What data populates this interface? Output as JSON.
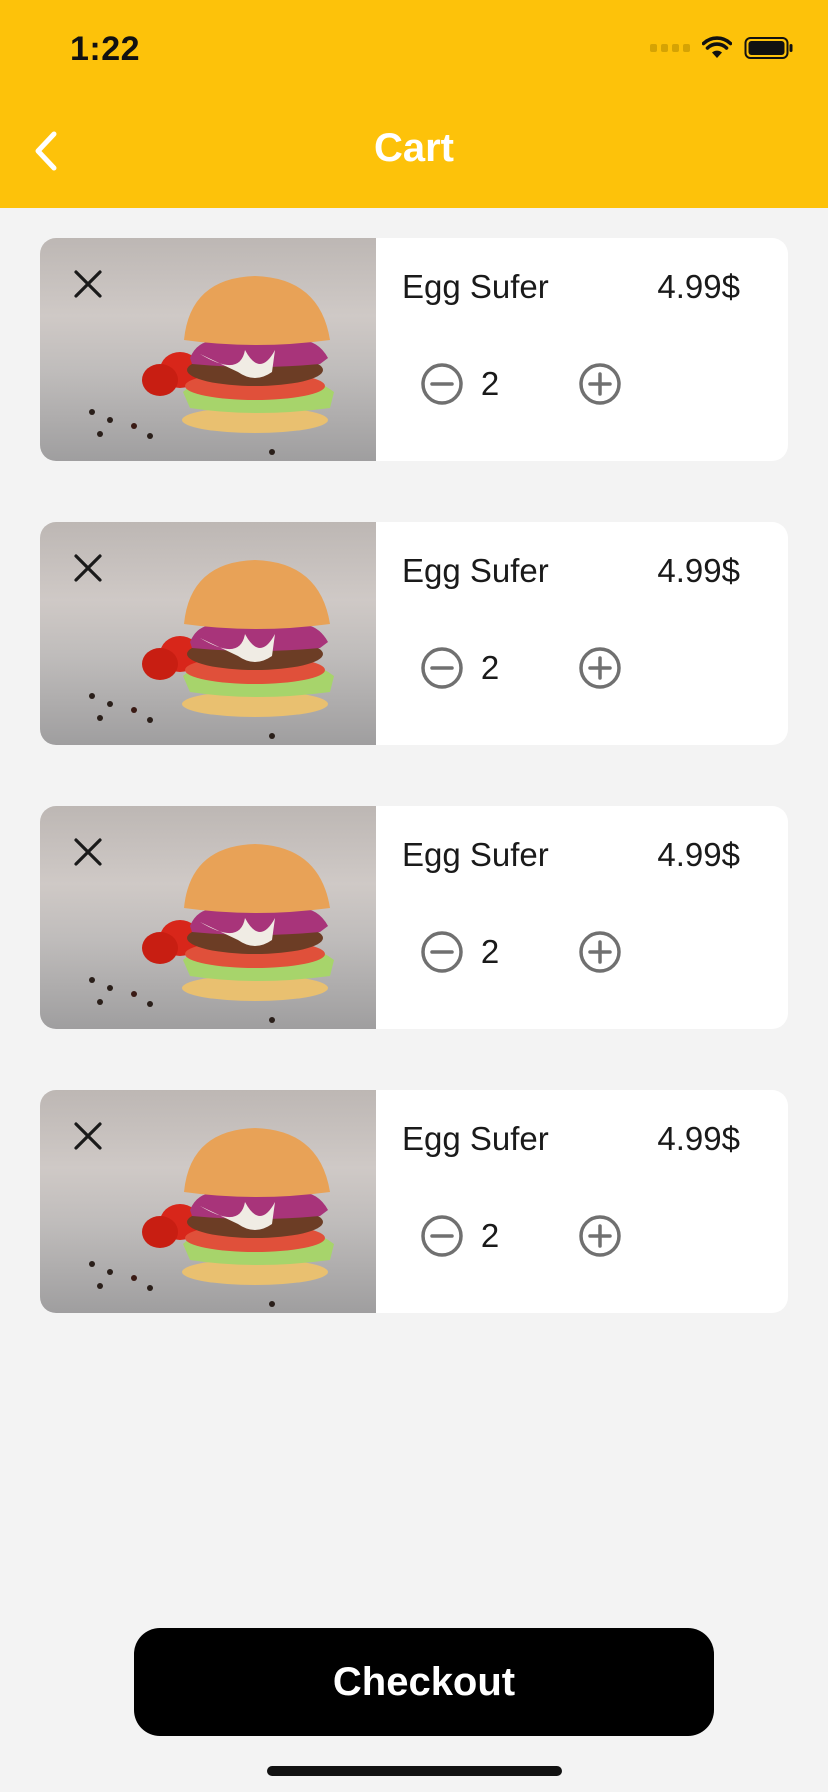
{
  "status_bar": {
    "time": "1:22"
  },
  "header": {
    "title": "Cart"
  },
  "colors": {
    "header_bg": "#fdc20a",
    "background": "#f3f3f3",
    "button_bg": "#000000"
  },
  "cart": {
    "items": [
      {
        "name": "Egg Sufer",
        "price": "4.99$",
        "quantity": "2",
        "image": "burger-image"
      },
      {
        "name": "Egg Sufer",
        "price": "4.99$",
        "quantity": "2",
        "image": "burger-image"
      },
      {
        "name": "Egg Sufer",
        "price": "4.99$",
        "quantity": "2",
        "image": "burger-image"
      },
      {
        "name": "Egg Sufer",
        "price": "4.99$",
        "quantity": "2",
        "image": "burger-image"
      }
    ]
  },
  "footer": {
    "checkout_label": "Checkout"
  },
  "icons": {
    "back": "chevron-left-icon",
    "remove": "close-icon",
    "decrease": "minus-circle-icon",
    "increase": "plus-circle-icon",
    "wifi": "wifi-icon",
    "battery": "battery-icon",
    "signal": "signal-icon"
  }
}
